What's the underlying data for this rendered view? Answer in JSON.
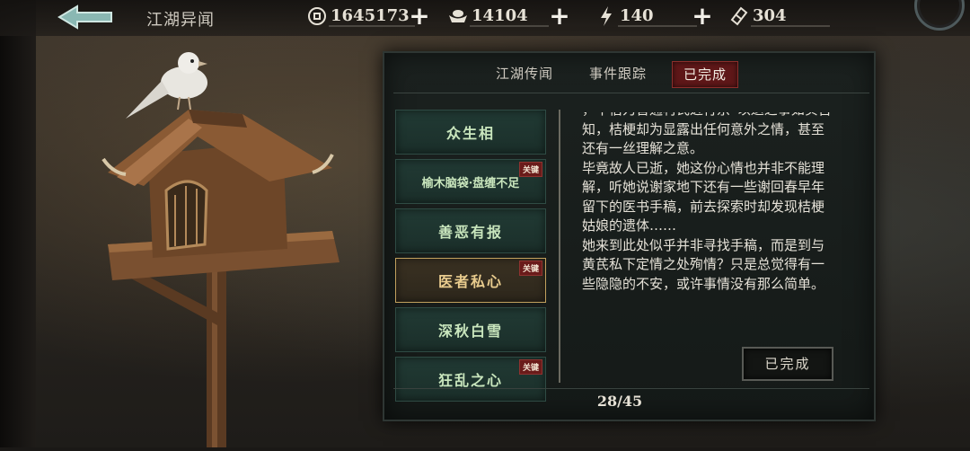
{
  "header": {
    "title": "江湖异闻"
  },
  "resources": {
    "coins": "1645173",
    "silver": "14104",
    "stamina": "140",
    "tickets": "304"
  },
  "tabs": [
    {
      "label": "江湖传闻"
    },
    {
      "label": "事件跟踪"
    },
    {
      "label": "已完成",
      "active": true
    }
  ],
  "events": [
    {
      "label": "众生相",
      "key": false
    },
    {
      "label": "榆木脑袋·盘缠不足",
      "key": true,
      "badge": "关键"
    },
    {
      "label": "善恶有报",
      "key": false
    },
    {
      "label": "医者私心",
      "key": true,
      "badge": "关键",
      "selected": true
    },
    {
      "label": "深秋白雪",
      "key": false
    },
    {
      "label": "狂乱之心",
      "key": true,
      "badge": "关键"
    }
  ],
  "detail": {
    "paragraphs": [
      "，不宿为音通村氏近行京“以退之事如实告知，桔梗却为显露出任何意外之情，甚至还有一丝理解之意。",
      "毕竟故人已逝，她这份心情也并非不能理解，听她说谢家地下还有一些谢回春早年留下的医书手稿，前去探索时却发现桔梗姑娘的遗体……",
      "她来到此处似乎并非寻找手稿，而是到与黄芪私下定情之处殉情？只是总觉得有一些隐隐的不安，或许事情没有那么简单。"
    ],
    "status_button": "已完成"
  },
  "pager": "28/45",
  "colors": {
    "active_tab": "#5e1718",
    "item_green": "#213a34",
    "item_selected_border": "#c2a15e",
    "badge_red": "#6a1b1a"
  }
}
